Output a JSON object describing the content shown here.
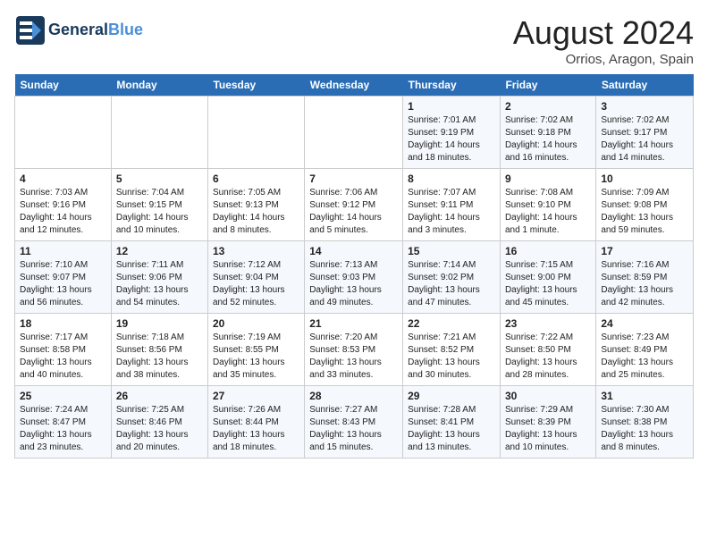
{
  "header": {
    "logo_general": "General",
    "logo_blue": "Blue",
    "title": "August 2024",
    "subtitle": "Orrios, Aragon, Spain"
  },
  "days_of_week": [
    "Sunday",
    "Monday",
    "Tuesday",
    "Wednesday",
    "Thursday",
    "Friday",
    "Saturday"
  ],
  "weeks": [
    [
      {
        "day": "",
        "info": ""
      },
      {
        "day": "",
        "info": ""
      },
      {
        "day": "",
        "info": ""
      },
      {
        "day": "",
        "info": ""
      },
      {
        "day": "1",
        "info": "Sunrise: 7:01 AM\nSunset: 9:19 PM\nDaylight: 14 hours\nand 18 minutes."
      },
      {
        "day": "2",
        "info": "Sunrise: 7:02 AM\nSunset: 9:18 PM\nDaylight: 14 hours\nand 16 minutes."
      },
      {
        "day": "3",
        "info": "Sunrise: 7:02 AM\nSunset: 9:17 PM\nDaylight: 14 hours\nand 14 minutes."
      }
    ],
    [
      {
        "day": "4",
        "info": "Sunrise: 7:03 AM\nSunset: 9:16 PM\nDaylight: 14 hours\nand 12 minutes."
      },
      {
        "day": "5",
        "info": "Sunrise: 7:04 AM\nSunset: 9:15 PM\nDaylight: 14 hours\nand 10 minutes."
      },
      {
        "day": "6",
        "info": "Sunrise: 7:05 AM\nSunset: 9:13 PM\nDaylight: 14 hours\nand 8 minutes."
      },
      {
        "day": "7",
        "info": "Sunrise: 7:06 AM\nSunset: 9:12 PM\nDaylight: 14 hours\nand 5 minutes."
      },
      {
        "day": "8",
        "info": "Sunrise: 7:07 AM\nSunset: 9:11 PM\nDaylight: 14 hours\nand 3 minutes."
      },
      {
        "day": "9",
        "info": "Sunrise: 7:08 AM\nSunset: 9:10 PM\nDaylight: 14 hours\nand 1 minute."
      },
      {
        "day": "10",
        "info": "Sunrise: 7:09 AM\nSunset: 9:08 PM\nDaylight: 13 hours\nand 59 minutes."
      }
    ],
    [
      {
        "day": "11",
        "info": "Sunrise: 7:10 AM\nSunset: 9:07 PM\nDaylight: 13 hours\nand 56 minutes."
      },
      {
        "day": "12",
        "info": "Sunrise: 7:11 AM\nSunset: 9:06 PM\nDaylight: 13 hours\nand 54 minutes."
      },
      {
        "day": "13",
        "info": "Sunrise: 7:12 AM\nSunset: 9:04 PM\nDaylight: 13 hours\nand 52 minutes."
      },
      {
        "day": "14",
        "info": "Sunrise: 7:13 AM\nSunset: 9:03 PM\nDaylight: 13 hours\nand 49 minutes."
      },
      {
        "day": "15",
        "info": "Sunrise: 7:14 AM\nSunset: 9:02 PM\nDaylight: 13 hours\nand 47 minutes."
      },
      {
        "day": "16",
        "info": "Sunrise: 7:15 AM\nSunset: 9:00 PM\nDaylight: 13 hours\nand 45 minutes."
      },
      {
        "day": "17",
        "info": "Sunrise: 7:16 AM\nSunset: 8:59 PM\nDaylight: 13 hours\nand 42 minutes."
      }
    ],
    [
      {
        "day": "18",
        "info": "Sunrise: 7:17 AM\nSunset: 8:58 PM\nDaylight: 13 hours\nand 40 minutes."
      },
      {
        "day": "19",
        "info": "Sunrise: 7:18 AM\nSunset: 8:56 PM\nDaylight: 13 hours\nand 38 minutes."
      },
      {
        "day": "20",
        "info": "Sunrise: 7:19 AM\nSunset: 8:55 PM\nDaylight: 13 hours\nand 35 minutes."
      },
      {
        "day": "21",
        "info": "Sunrise: 7:20 AM\nSunset: 8:53 PM\nDaylight: 13 hours\nand 33 minutes."
      },
      {
        "day": "22",
        "info": "Sunrise: 7:21 AM\nSunset: 8:52 PM\nDaylight: 13 hours\nand 30 minutes."
      },
      {
        "day": "23",
        "info": "Sunrise: 7:22 AM\nSunset: 8:50 PM\nDaylight: 13 hours\nand 28 minutes."
      },
      {
        "day": "24",
        "info": "Sunrise: 7:23 AM\nSunset: 8:49 PM\nDaylight: 13 hours\nand 25 minutes."
      }
    ],
    [
      {
        "day": "25",
        "info": "Sunrise: 7:24 AM\nSunset: 8:47 PM\nDaylight: 13 hours\nand 23 minutes."
      },
      {
        "day": "26",
        "info": "Sunrise: 7:25 AM\nSunset: 8:46 PM\nDaylight: 13 hours\nand 20 minutes."
      },
      {
        "day": "27",
        "info": "Sunrise: 7:26 AM\nSunset: 8:44 PM\nDaylight: 13 hours\nand 18 minutes."
      },
      {
        "day": "28",
        "info": "Sunrise: 7:27 AM\nSunset: 8:43 PM\nDaylight: 13 hours\nand 15 minutes."
      },
      {
        "day": "29",
        "info": "Sunrise: 7:28 AM\nSunset: 8:41 PM\nDaylight: 13 hours\nand 13 minutes."
      },
      {
        "day": "30",
        "info": "Sunrise: 7:29 AM\nSunset: 8:39 PM\nDaylight: 13 hours\nand 10 minutes."
      },
      {
        "day": "31",
        "info": "Sunrise: 7:30 AM\nSunset: 8:38 PM\nDaylight: 13 hours\nand 8 minutes."
      }
    ]
  ]
}
